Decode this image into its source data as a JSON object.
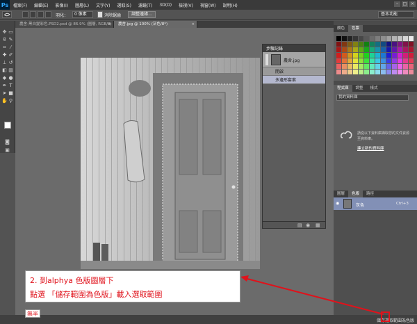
{
  "app": {
    "logo": "Ps"
  },
  "menubar": {
    "items": [
      "檔案(F)",
      "編輯(E)",
      "影像(I)",
      "圖層(L)",
      "文字(Y)",
      "選取(S)",
      "濾鏡(T)",
      "3D(D)",
      "檢視(V)",
      "視窗(W)",
      "說明(H)"
    ],
    "window_buttons": [
      "–",
      "□",
      "×"
    ]
  },
  "options_bar": {
    "feather_label": "羽化：",
    "feather_value": "0 像素",
    "antialias_label": "消除鋸齒",
    "refine_edge_button": "調整邊緣...",
    "workspace": "基本功能"
  },
  "tabs": [
    {
      "label": "農舍-黑白變彩色.PSD2.psd @ 86.9% (圖層, RGB/8)",
      "close": "×"
    },
    {
      "label": "農舍.jpg @ 100% (灰色/8*)",
      "close": "×"
    }
  ],
  "history_panel": {
    "title": "步驟記錄",
    "snapshot_label": "農舍.jpg",
    "steps": [
      "開啟",
      "多邊形套索"
    ]
  },
  "panels": {
    "swatches_tabs": [
      "顏色",
      "色票"
    ],
    "library_tabs": [
      "程式庫",
      "調整",
      "樣式"
    ],
    "library_select": "我的資料庫",
    "cc_text_1": "請從以下資料庫擷取您的文件資源",
    "cc_text_2": "至資料庫。",
    "cc_link": "建立新的資料庫",
    "layers_tabs": [
      "圖層",
      "色版",
      "路徑"
    ],
    "channel_label": "灰色",
    "channel_shortcut": "Ctrl+3"
  },
  "status": {
    "left_text": "無半",
    "right_text": "儲存選取範圍為色版"
  },
  "annotation": {
    "line1": "2. 到alphya 色版圖層下",
    "line2": "點選 「儲存範圍為色版」載入選取範圍",
    "color": "#e0121b"
  },
  "tool_icons": [
    "move-tool-icon",
    "marquee-tool-icon",
    "lasso-tool-icon",
    "quick-select-tool-icon",
    "crop-tool-icon",
    "eyedropper-tool-icon",
    "healing-tool-icon",
    "brush-tool-icon",
    "clone-tool-icon",
    "history-brush-tool-icon",
    "eraser-tool-icon",
    "gradient-tool-icon",
    "blur-tool-icon",
    "dodge-tool-icon",
    "pen-tool-icon",
    "type-tool-icon",
    "path-select-tool-icon",
    "shape-tool-icon",
    "hand-tool-icon",
    "zoom-tool-icon"
  ]
}
